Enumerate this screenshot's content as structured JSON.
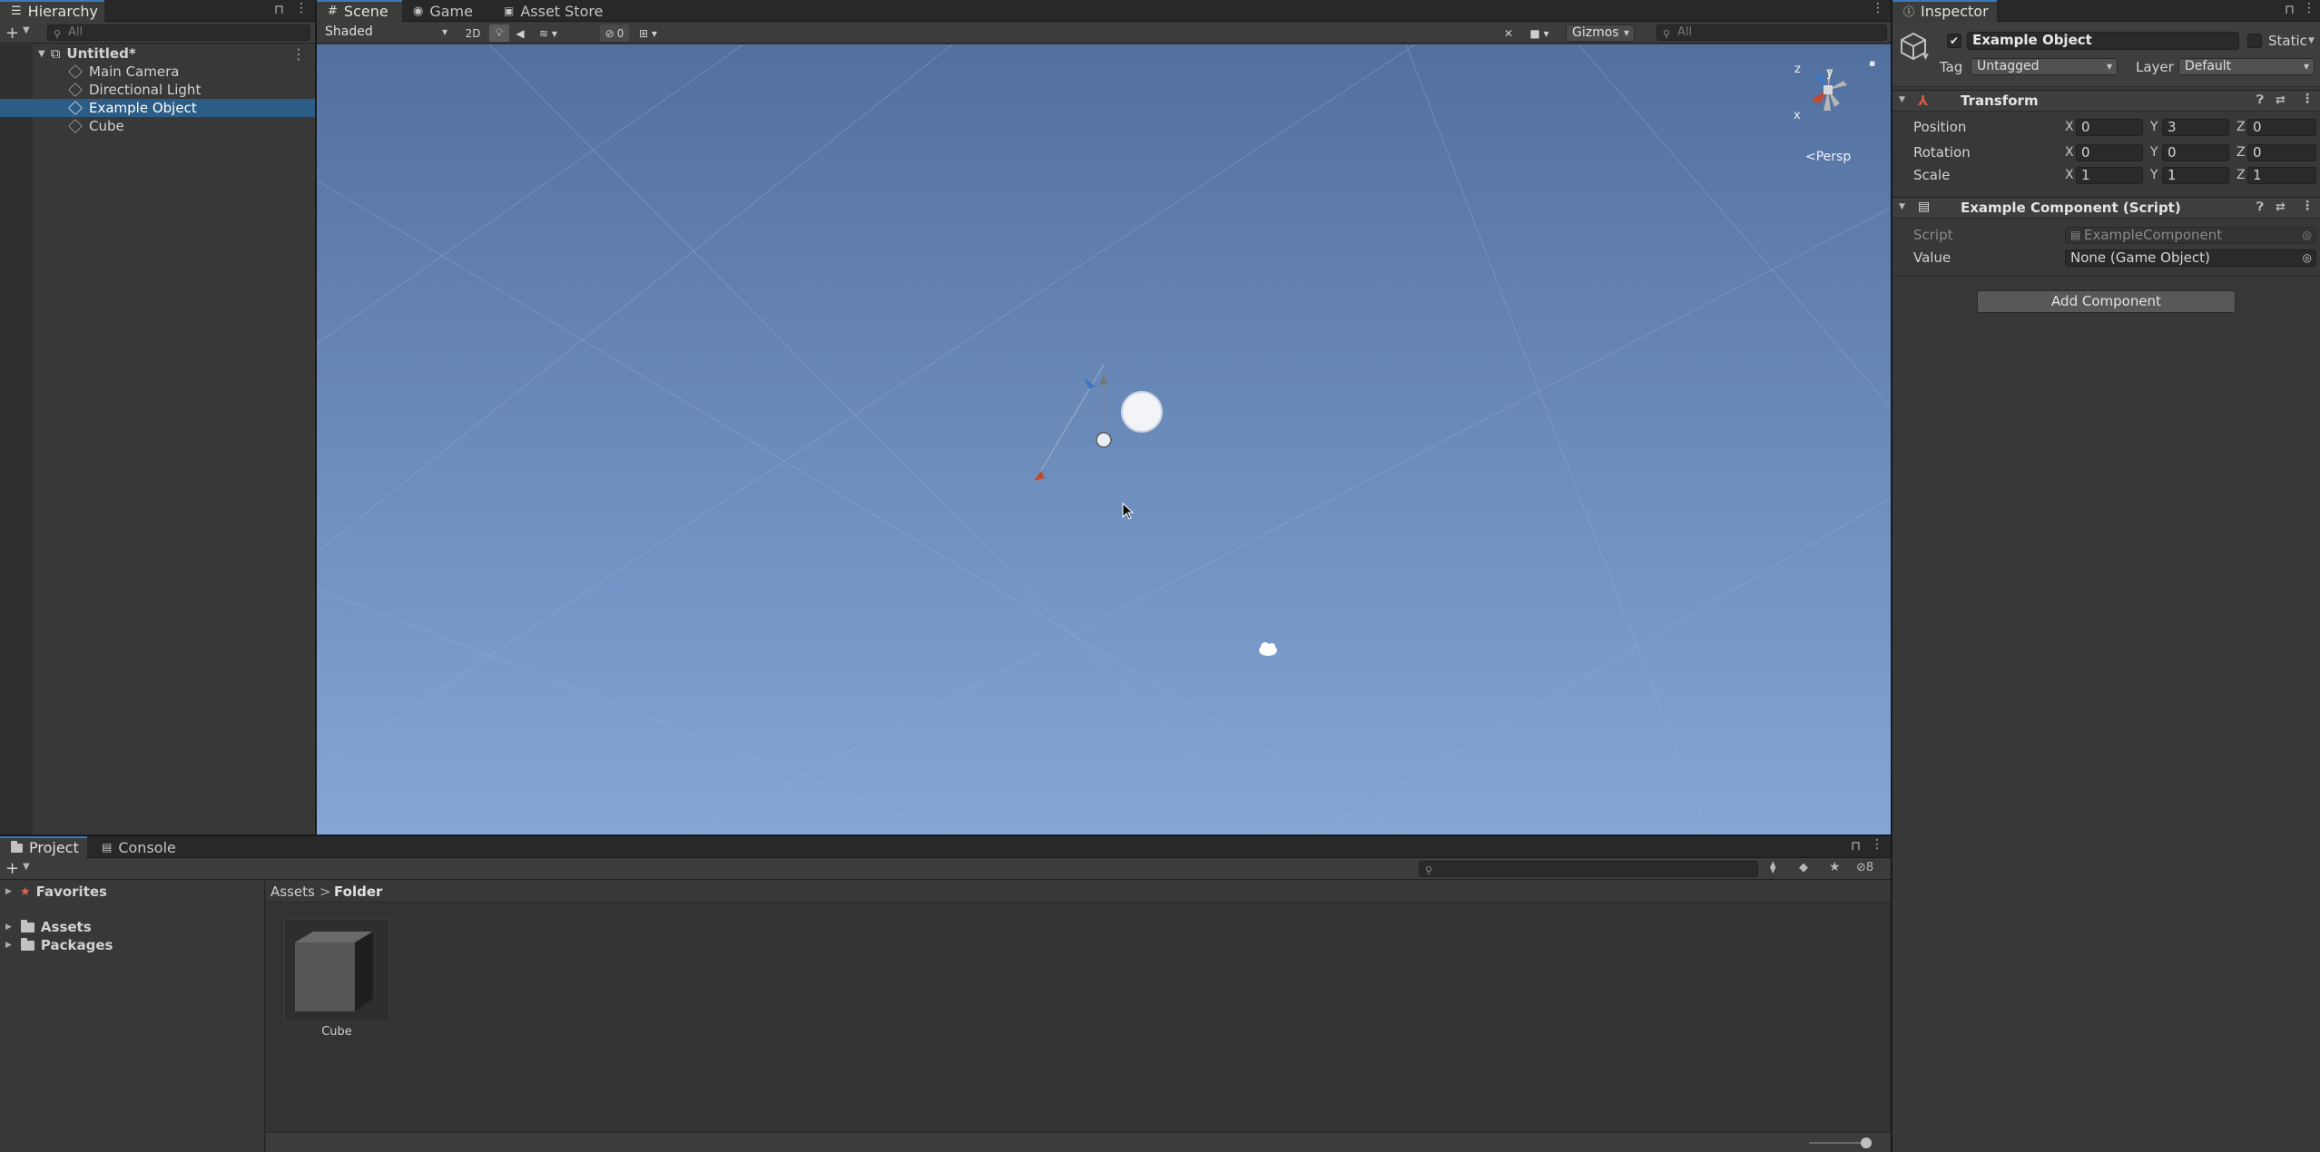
{
  "hierarchy": {
    "tab_label": "Hierarchy",
    "search_placeholder": "All",
    "scene_name": "Untitled*",
    "items": [
      {
        "label": "Main Camera"
      },
      {
        "label": "Directional Light"
      },
      {
        "label": "Example Object",
        "selected": true
      },
      {
        "label": "Cube"
      }
    ]
  },
  "scene_view": {
    "tabs": {
      "scene": "Scene",
      "game": "Game",
      "asset_store": "Asset Store"
    },
    "toolbar": {
      "shading_mode": "Shaded",
      "mode_2d": "2D",
      "hidden_count": "0",
      "gizmos": "Gizmos",
      "search_placeholder": "All"
    },
    "orientation": {
      "x": "x",
      "y": "y",
      "z": "z",
      "projection": "Persp"
    },
    "sky_color_top": "#52709f",
    "sky_color_bottom": "#84a6d6"
  },
  "inspector": {
    "tab_label": "Inspector",
    "object_name": "Example Object",
    "static_label": "Static",
    "tag_label": "Tag",
    "tag_value": "Untagged",
    "layer_label": "Layer",
    "layer_value": "Default",
    "transform": {
      "title": "Transform",
      "position": {
        "label": "Position",
        "x": "0",
        "y": "3",
        "z": "0"
      },
      "rotation": {
        "label": "Rotation",
        "x": "0",
        "y": "0",
        "z": "0"
      },
      "scale": {
        "label": "Scale",
        "x": "1",
        "y": "1",
        "z": "1"
      },
      "axis_x": "X",
      "axis_y": "Y",
      "axis_z": "Z"
    },
    "component": {
      "title": "Example Component (Script)",
      "script_label": "Script",
      "script_value": "ExampleComponent",
      "value_label": "Value",
      "value_value": "None (Game Object)"
    },
    "add_component": "Add Component"
  },
  "project": {
    "tabs": {
      "project": "Project",
      "console": "Console"
    },
    "tree": {
      "favorites": "Favorites",
      "assets": "Assets",
      "packages": "Packages"
    },
    "breadcrumb": {
      "root": "Assets",
      "separator": ">",
      "current": "Folder"
    },
    "hidden_count": "8",
    "assets": [
      {
        "label": "Cube"
      }
    ]
  },
  "colors": {
    "selection": "#2c5d87",
    "accent": "#3a79bb"
  }
}
